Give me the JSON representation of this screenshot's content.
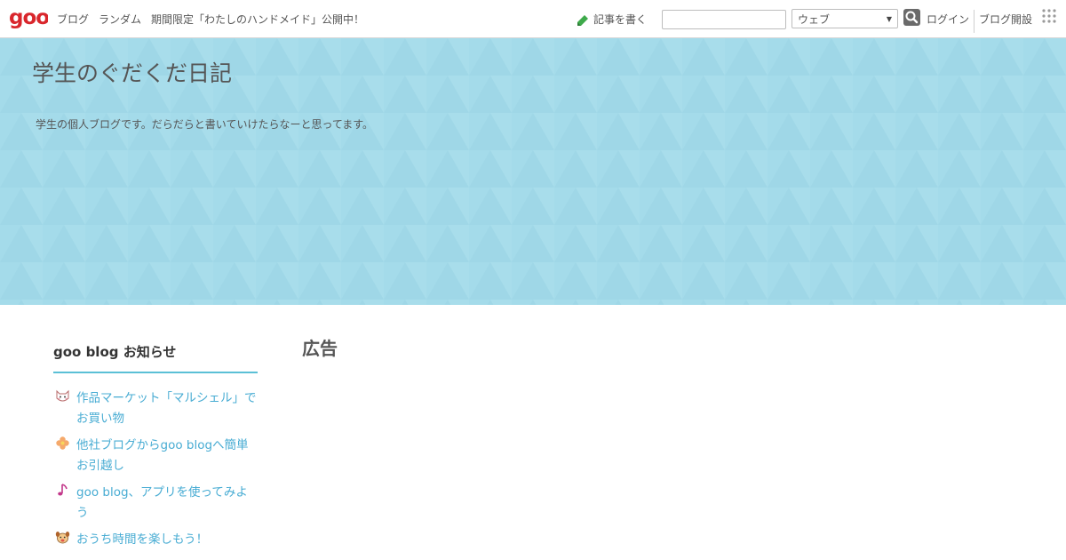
{
  "topbar": {
    "logo_text": "goo",
    "nav": [
      "ブログ",
      "ランダム",
      "期間限定「わたしのハンドメイド」公開中！"
    ],
    "write_label": "記事を書く",
    "search_placeholder": "",
    "search_scope": "ウェブ",
    "login_label": "ログイン",
    "open_blog_label": "ブログ開設"
  },
  "banner": {
    "title": "学生のぐだくだ日記",
    "description": "学生の個人ブログです。だらだらと書いていけたらなーと思ってます。"
  },
  "sidebar": {
    "heading": "goo blog お知らせ",
    "items": [
      {
        "label": "作品マーケット「マルシェル」でお買い物",
        "icon": "cat-face-icon"
      },
      {
        "label": "他社ブログからgoo blogへ簡単お引越し",
        "icon": "clover-icon"
      },
      {
        "label": "goo blog、アプリを使ってみよう",
        "icon": "music-note-icon"
      },
      {
        "label": "おうち時間を楽しもう！",
        "icon": "dog-face-icon"
      }
    ]
  },
  "main": {
    "ad_heading": "広告"
  },
  "colors": {
    "banner_bg": "#a4dbea",
    "accent": "#5bc0d6",
    "link": "#48acd3",
    "logo_red": "#d9262c"
  }
}
